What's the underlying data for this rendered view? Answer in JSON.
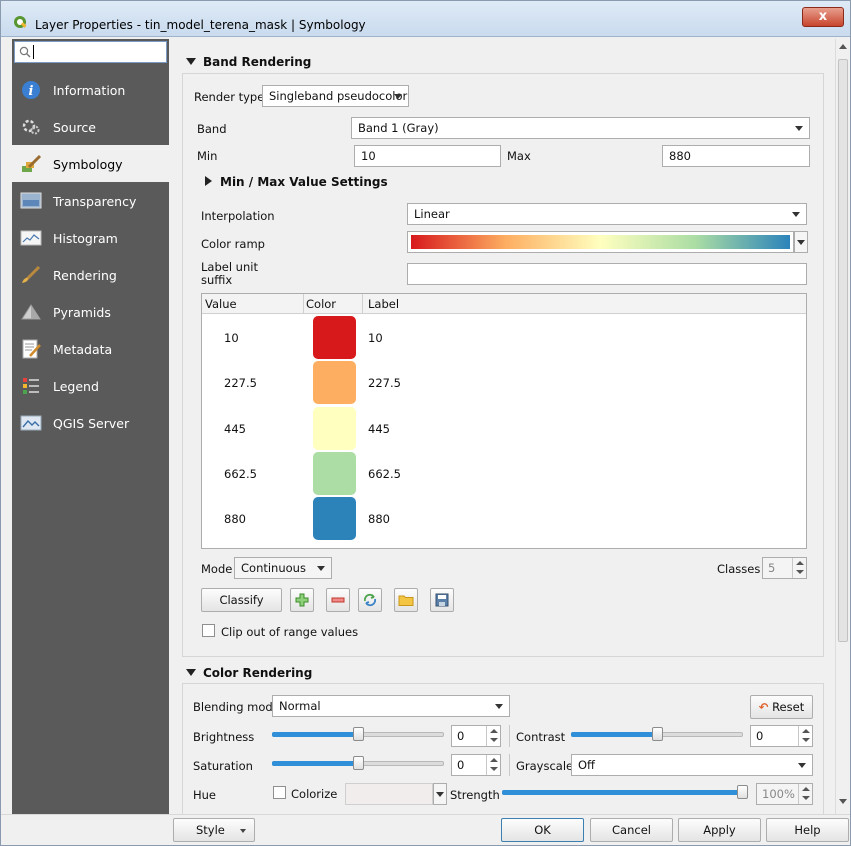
{
  "window": {
    "title": "Layer Properties - tin_model_terena_mask | Symbology",
    "close_label": "x"
  },
  "sidebar": {
    "search_placeholder": "",
    "items": [
      {
        "label": "Information",
        "icon": "info-icon"
      },
      {
        "label": "Source",
        "icon": "source-icon"
      },
      {
        "label": "Symbology",
        "icon": "symbology-brush-icon",
        "active": true
      },
      {
        "label": "Transparency",
        "icon": "transparency-icon"
      },
      {
        "label": "Histogram",
        "icon": "histogram-icon"
      },
      {
        "label": "Rendering",
        "icon": "rendering-brush-icon"
      },
      {
        "label": "Pyramids",
        "icon": "pyramids-icon"
      },
      {
        "label": "Metadata",
        "icon": "metadata-icon"
      },
      {
        "label": "Legend",
        "icon": "legend-icon"
      },
      {
        "label": "QGIS Server",
        "icon": "qgis-server-icon"
      }
    ]
  },
  "band_rendering": {
    "header": "Band Rendering",
    "render_type_label": "Render type",
    "render_type_value": "Singleband pseudocolor",
    "band_label": "Band",
    "band_value": "Band 1 (Gray)",
    "min_label": "Min",
    "min_value": "10",
    "max_label": "Max",
    "max_value": "880",
    "minmax_settings": "Min / Max Value Settings",
    "interpolation_label": "Interpolation",
    "interpolation_value": "Linear",
    "color_ramp_label": "Color ramp",
    "label_unit_label_1": "Label unit",
    "label_unit_label_2": "suffix",
    "label_unit_value": "",
    "table": {
      "columns": [
        "Value",
        "Color",
        "Label"
      ],
      "rows": [
        {
          "value": "10",
          "color": "#d7191c",
          "label": "10"
        },
        {
          "value": "227.5",
          "color": "#fdae61",
          "label": "227.5"
        },
        {
          "value": "445",
          "color": "#ffffbf",
          "label": "445"
        },
        {
          "value": "662.5",
          "color": "#abdda4",
          "label": "662.5"
        },
        {
          "value": "880",
          "color": "#2b83ba",
          "label": "880"
        }
      ]
    },
    "mode_label": "Mode",
    "mode_value": "Continuous",
    "classes_label": "Classes",
    "classes_value": "5",
    "classify_label": "Classify",
    "clip_label": "Clip out of range values"
  },
  "color_rendering": {
    "header": "Color Rendering",
    "blending_label": "Blending mode",
    "blending_value": "Normal",
    "reset_label": "Reset",
    "brightness_label": "Brightness",
    "brightness_value": "0",
    "contrast_label": "Contrast",
    "contrast_value": "0",
    "saturation_label": "Saturation",
    "saturation_value": "0",
    "grayscale_label": "Grayscale",
    "grayscale_value": "Off",
    "hue_label": "Hue",
    "colorize_label": "Colorize",
    "strength_label": "Strength",
    "strength_value": "100%",
    "brightness_level": 0.5,
    "contrast_level": 0.5,
    "saturation_level": 0.5,
    "strength_level": 1.0
  },
  "footer": {
    "style_label": "Style",
    "ok_label": "OK",
    "cancel_label": "Cancel",
    "apply_label": "Apply",
    "help_label": "Help"
  },
  "colors": {
    "sidebar_bg": "#5a5a5a",
    "slider_accent": "#2f8fd8",
    "ramp": [
      "#d7191c",
      "#fdae61",
      "#ffffbf",
      "#abdda4",
      "#2b83ba"
    ]
  }
}
